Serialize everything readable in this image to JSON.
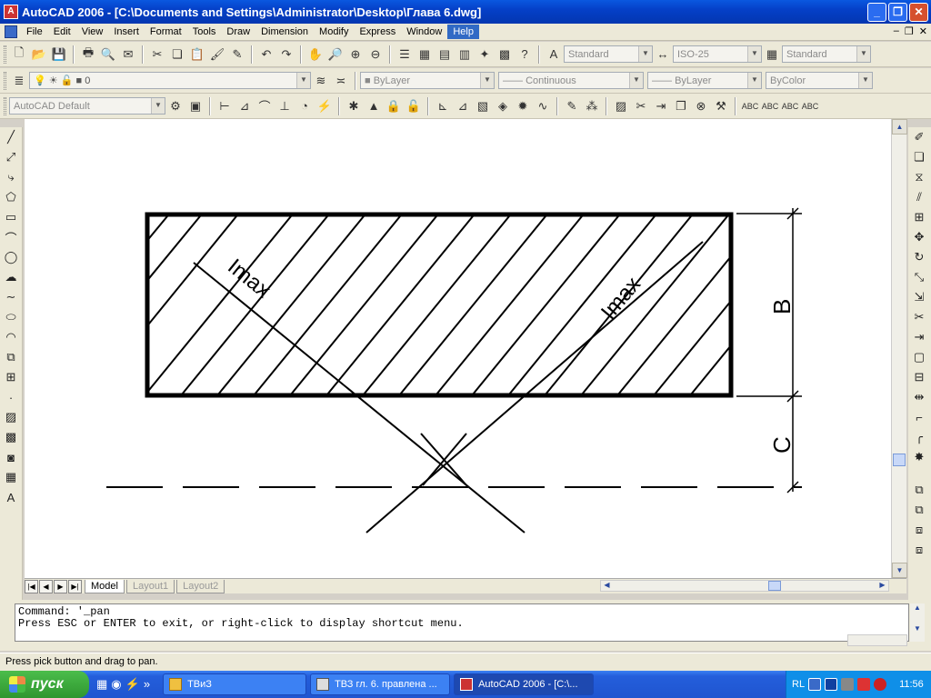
{
  "titlebar": {
    "app_icon": "A",
    "title": "AutoCAD 2006 - [C:\\Documents and Settings\\Administrator\\Desktop\\Глава 6.dwg]",
    "minimize": "_",
    "restore": "❐",
    "close": "✕"
  },
  "menu": {
    "items": [
      "File",
      "Edit",
      "View",
      "Insert",
      "Format",
      "Tools",
      "Draw",
      "Dimension",
      "Modify",
      "Express",
      "Window",
      "Help"
    ],
    "active_index": 11,
    "mdi_min": "–",
    "mdi_restore": "❐",
    "mdi_close": "✕"
  },
  "toolbars": {
    "text_style": "Standard",
    "dim_style": "ISO-25",
    "table_style": "Standard",
    "layer": "0",
    "color": "ByLayer",
    "linetype": "Continuous",
    "lineweight": "ByLayer",
    "plotstyle": "ByColor",
    "workspace": "AutoCAD Default"
  },
  "drawing": {
    "label_imax_left": "Imax",
    "label_imax_right": "Imax",
    "dim_b": "B",
    "dim_c": "C"
  },
  "tabs": [
    "Model",
    "Layout1",
    "Layout2"
  ],
  "command": {
    "line1": "Command: '_pan",
    "line2": "Press ESC or ENTER to exit, or right-click to display shortcut menu."
  },
  "status": "Press pick button and drag to pan.",
  "taskbar": {
    "start": "пуск",
    "tasks": [
      "ТВиЗ",
      "ТВЗ гл. 6. правлена ...",
      "AutoCAD 2006 - [C:\\..."
    ],
    "active_task_index": 2,
    "lang": "RL",
    "clock": "11:56"
  },
  "colors": {
    "titlebar": "#0a58e0",
    "menu_active": "#316ac5",
    "taskbar": "#245edb",
    "start": "#2f962f"
  }
}
